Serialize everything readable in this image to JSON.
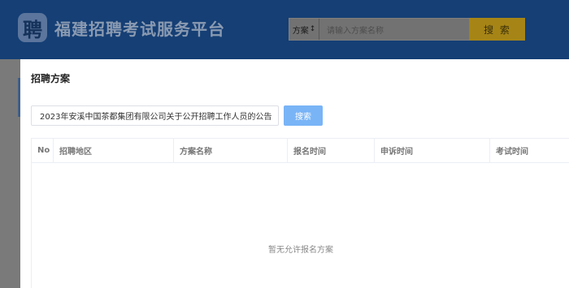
{
  "header": {
    "logo_char": "聘",
    "title": "福建招聘考试服务平台",
    "search": {
      "select_label": "方案",
      "select_arrow": "↕",
      "placeholder": "请输入方案名称",
      "button_label": "搜 索"
    }
  },
  "modal": {
    "title": "招聘方案",
    "search_value": "2023年安溪中国茶都集团有限公司关于公开招聘工作人员的公告",
    "search_button": "搜索",
    "table": {
      "columns": [
        "No",
        "招聘地区",
        "方案名称",
        "报名时间",
        "申诉时间",
        "考试时间"
      ]
    },
    "empty_text": "暂无允许报名方案"
  },
  "colors": {
    "header_bg": "#1a4d8f",
    "search_btn": "#a68516",
    "modal_btn": "#79b4f7"
  }
}
